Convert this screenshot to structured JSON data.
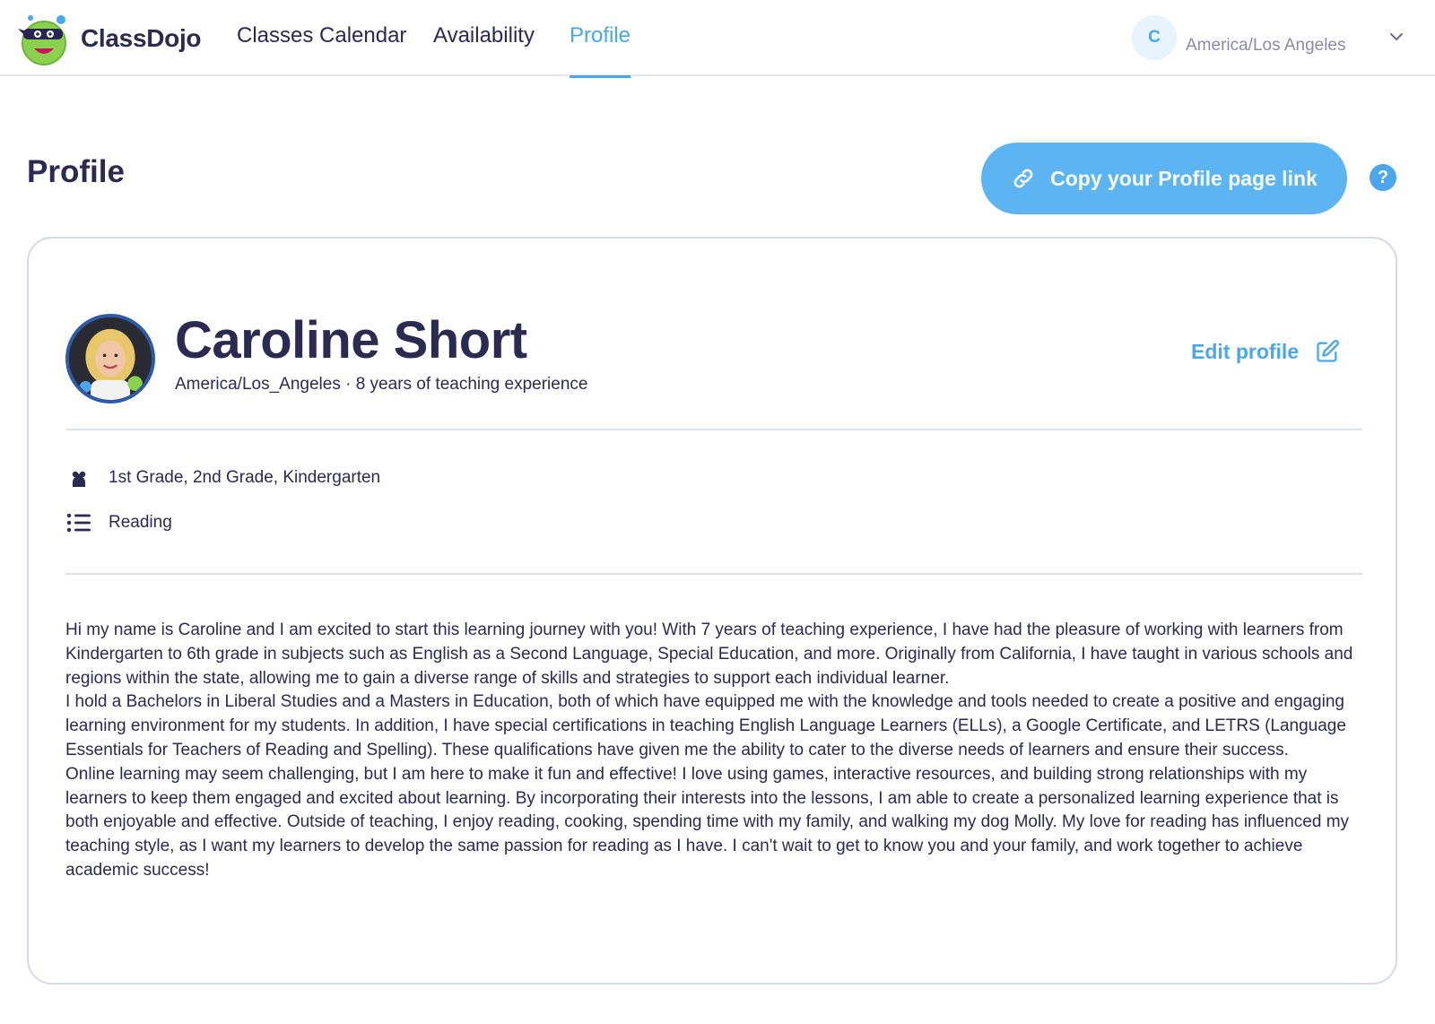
{
  "app": {
    "name": "ClassDojo",
    "brand_color": "#4aa7ee"
  },
  "nav": {
    "tabs": [
      {
        "label": "Classes Calendar",
        "active": false
      },
      {
        "label": "Availability",
        "active": false
      },
      {
        "label": "Profile",
        "active": true
      }
    ]
  },
  "account": {
    "avatar_initial": "C",
    "timezone": "America/Los Angeles",
    "icon": "chevron-down-icon"
  },
  "page": {
    "title": "Profile",
    "copy_link_label": "Copy your Profile page link",
    "help_label": "?"
  },
  "profile": {
    "name": "Caroline Short",
    "meta": "America/Los_Angeles · 8 years of teaching experience",
    "edit_label": "Edit profile",
    "grades": "1st Grade, 2nd Grade, Kindergarten",
    "subjects": "Reading",
    "bio": [
      "Hi my name is Caroline and I am excited to start this learning journey with you! With 7 years of teaching experience, I have had the pleasure of working with learners from Kindergarten to 6th grade in subjects such as English as a Second Language, Special Education, and more. Originally from California, I have taught in various schools and regions within the state, allowing me to gain a diverse range of skills and strategies to support each individual learner.",
      "I hold a Bachelors in Liberal Studies and a Masters in Education, both of which have equipped me with the knowledge and tools needed to create a positive and engaging learning environment for my students. In addition, I have special certifications in teaching English Language Learners (ELLs), a Google Certificate, and LETRS (Language Essentials for Teachers of Reading and Spelling). These qualifications have given me the ability to cater to the diverse needs of learners and ensure their success.",
      "Online learning may seem challenging, but I am here to make it fun and effective! I love using games, interactive resources, and building strong relationships with my learners to keep them engaged and excited about learning. By incorporating their interests into the lessons, I am able to create a personalized learning experience that is both enjoyable and effective. Outside of teaching, I enjoy reading, cooking, spending time with my family, and walking my dog Molly. My love for reading has influenced my teaching style, as I want my learners to develop the same passion for reading as I have. I can't wait to get to know you and your family, and work together to achieve academic success!"
    ]
  }
}
